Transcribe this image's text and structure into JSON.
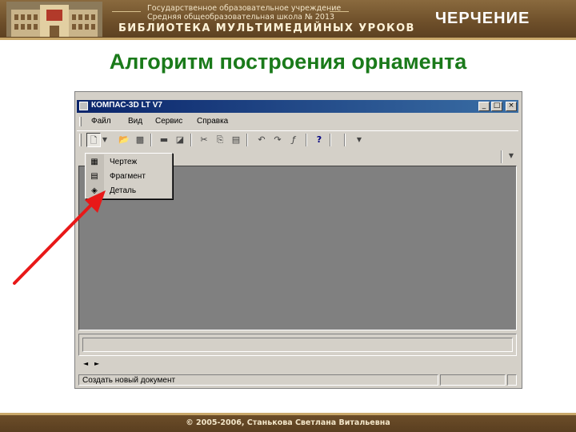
{
  "header": {
    "school_line1": "Государственное образовательное учреждение",
    "school_line2": "Средняя общеобразовательная школа № 2013",
    "library_title": "БИБЛИОТЕКА МУЛЬТИМЕДИЙНЫХ УРОКОВ",
    "subject": "ЧЕРЧЕНИЕ"
  },
  "slide_title": "Алгоритм построения орнамента",
  "app": {
    "window_title": "КОМПАС-3D LT V7",
    "window_buttons": [
      "_",
      "□",
      "×"
    ],
    "menu": [
      "Файл",
      "Вид",
      "Сервис",
      "Справка"
    ],
    "dropdown_items": [
      {
        "label": "Чертеж",
        "icon": "drawing-icon"
      },
      {
        "label": "Фрагмент",
        "icon": "fragment-icon"
      },
      {
        "label": "Деталь",
        "icon": "part-icon"
      }
    ],
    "status_text": "Создать новый документ"
  },
  "footer": "© 2005-2006, Станькова Светлана Витальевна",
  "colors": {
    "title_green": "#1a7a1a",
    "banner_brown": "#6e4f2a",
    "arrow_red": "#e81818"
  }
}
